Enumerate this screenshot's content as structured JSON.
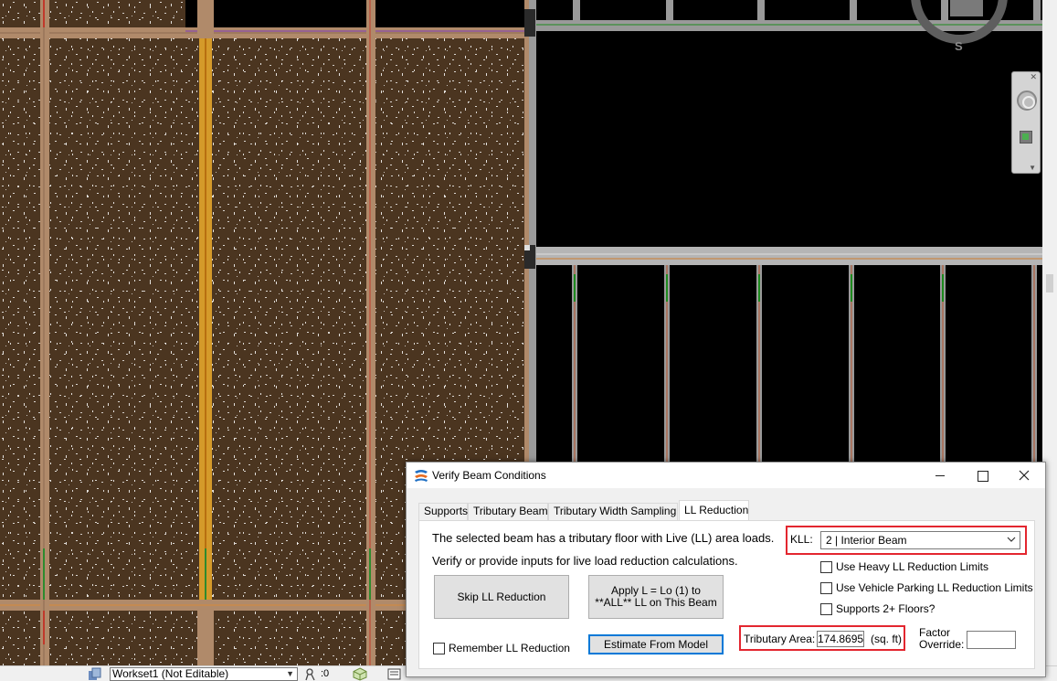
{
  "dialog": {
    "title": "Verify Beam Conditions",
    "tabs": [
      {
        "label": "Supports"
      },
      {
        "label": "Tributary Beams"
      },
      {
        "label": "Tributary Width Sampling"
      },
      {
        "label": "LL Reduction"
      }
    ],
    "active_tab": "LL Reduction",
    "message_line1": "The selected beam has a tributary floor with Live (LL) area loads.",
    "message_line2": "Verify or provide inputs for live load reduction calculations.",
    "skip_button": "Skip LL Reduction",
    "apply_button_line1": "Apply L = Lo (1) to",
    "apply_button_line2": "**ALL** LL on This Beam",
    "estimate_button": "Estimate From Model",
    "kll_label": "KLL:",
    "kll_value": "2  |  Interior Beam",
    "checkboxes": {
      "heavy_ll": {
        "label": "Use Heavy LL Reduction Limits",
        "checked": false
      },
      "vehicle_parking": {
        "label": "Use Vehicle Parking LL Reduction Limits",
        "checked": false
      },
      "supports_floors": {
        "label": "Supports 2+ Floors?",
        "checked": false
      },
      "remember": {
        "label": "Remember LL Reduction",
        "checked": false
      }
    },
    "tributary_area_label": "Tributary Area:",
    "tributary_area_value": "174.8695",
    "tributary_area_unit": "(sq. ft)",
    "factor_override_label_line1": "Factor",
    "factor_override_label_line2": "Override:",
    "factor_override_value": ""
  },
  "statusbar": {
    "workset": "Workset1 (Not Editable)",
    "count": ":0"
  },
  "viewcube": {
    "south_label": "S"
  },
  "colors": {
    "floor_fill": "#4b3520",
    "beam": "#b08a6a",
    "highlight_beam": "#d49a2a",
    "highlight_box": "#e3262f",
    "focus_button": "#0078d7"
  }
}
